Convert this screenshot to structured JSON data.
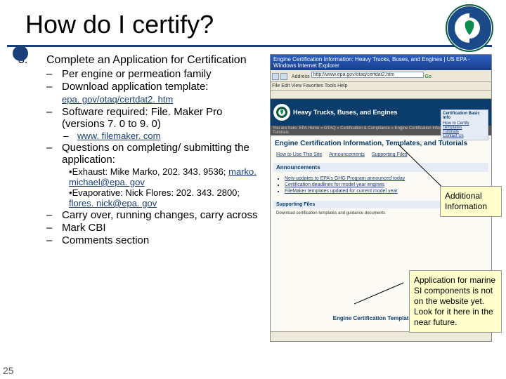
{
  "title": "How do I certify?",
  "step_num": "5.",
  "step_text": "Complete an Application for Certification",
  "items": {
    "i1": "Per engine or permeation family",
    "i2": "Download application template:",
    "i2_link": "epa. gov/otaq/certdat2. htm",
    "i3": "Software required:  File. Maker Pro (versions 7. 0 to 9. 0)",
    "i3_link": "www. filemaker. com",
    "i4": "Questions on completing/ submitting the application:",
    "i4a_pre": "Exhaust: Mike Marko, 202. 343. 9536;",
    "i4a_link": "marko. michael@epa. gov",
    "i4b_pre": "Evaporative: Nick Flores: 202. 343. 2800;",
    "i4b_link": "flores. nick@epa. gov",
    "i5": "Carry over, running changes, carry across",
    "i6": "Mark CBI",
    "i7": "Comments section"
  },
  "callout1": "Additional Information",
  "callout2": "Application for marine SI components is not on the website yet. Look for it here in the near future.",
  "page_num": "25",
  "browser": {
    "window_title": "Engine Certification Information: Heavy Trucks, Buses, and Engines | US EPA - Windows Internet Explorer",
    "menu": "File   Edit   View   Favorites   Tools   Help",
    "addr_label": "Address",
    "url": "http://www.epa.gov/otaq/certdat2.htm",
    "go": "Go",
    "epa_text": "Heavy Trucks, Buses, and Engines",
    "crumb": "You are here: EPA Home » OTAQ » Certification & Compliance » Engine Certification Information Templates and Tutorials",
    "page_title": "Engine Certification Information, Templates, and Tutorials",
    "subbar": "Announcements",
    "nav1": "How to Use This Site",
    "nav2": "Announcements",
    "nav3": "Supporting Files",
    "ann1": "New updates to EPA's GHG Program announced today",
    "ann2": "Certification deadlines for model year engines",
    "ann3": "FileMaker templates updated for current model year",
    "side_title": "Certification Basic Info",
    "side_l1": "How to Certify",
    "side_l2": "Templates",
    "side_l3": "Tutorials",
    "side_l4": "Contact Us",
    "sec1": "Supporting Files",
    "sec1_t1": "Download certification templates and guidance documents",
    "cert_title": "Engine Certification Templates"
  }
}
